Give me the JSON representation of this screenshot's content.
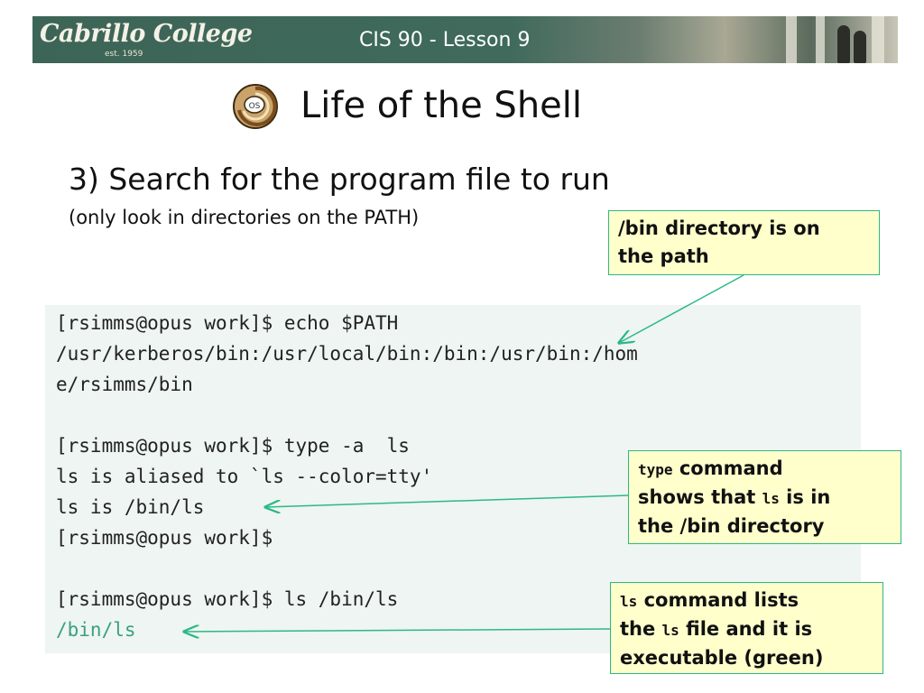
{
  "header": {
    "logo": "Cabrillo College",
    "logo_est": "est. 1959",
    "lesson": "CIS 90 - Lesson 9"
  },
  "slide": {
    "icon": "os-shell-icon",
    "icon_label": "OS",
    "title": "Life of the Shell",
    "heading": "3) Search for the program file to run",
    "subheading": "(only look in directories on the PATH)"
  },
  "terminal": {
    "lines": [
      "[rsimms@opus work]$ echo $PATH",
      "/usr/kerberos/bin:/usr/local/bin:/bin:/usr/bin:/hom",
      "e/rsimms/bin",
      "",
      "[rsimms@opus work]$ type -a  ls",
      "ls is aliased to `ls --color=tty'",
      "ls is /bin/ls",
      "[rsimms@opus work]$",
      "",
      "[rsimms@opus work]$ ls /bin/ls",
      "/bin/ls"
    ],
    "executable_color": "#3aa17e"
  },
  "callouts": {
    "path_note": {
      "line1": "/bin directory is on",
      "line2": "the path"
    },
    "type_note": {
      "code1": "type",
      "text1": " command",
      "text2": "shows that ",
      "code2": "ls",
      "text3": " is in",
      "line3": "the /bin directory"
    },
    "ls_note": {
      "code1": "ls",
      "text1": " command lists",
      "text2": "the ",
      "code2": "ls",
      "text3": " file and it is",
      "line3": "executable (green)"
    }
  },
  "colors": {
    "banner": "#3d6557",
    "callout_bg": "#ffffcc",
    "callout_border": "#2eb886",
    "terminal_bg": "#eef5f2"
  }
}
